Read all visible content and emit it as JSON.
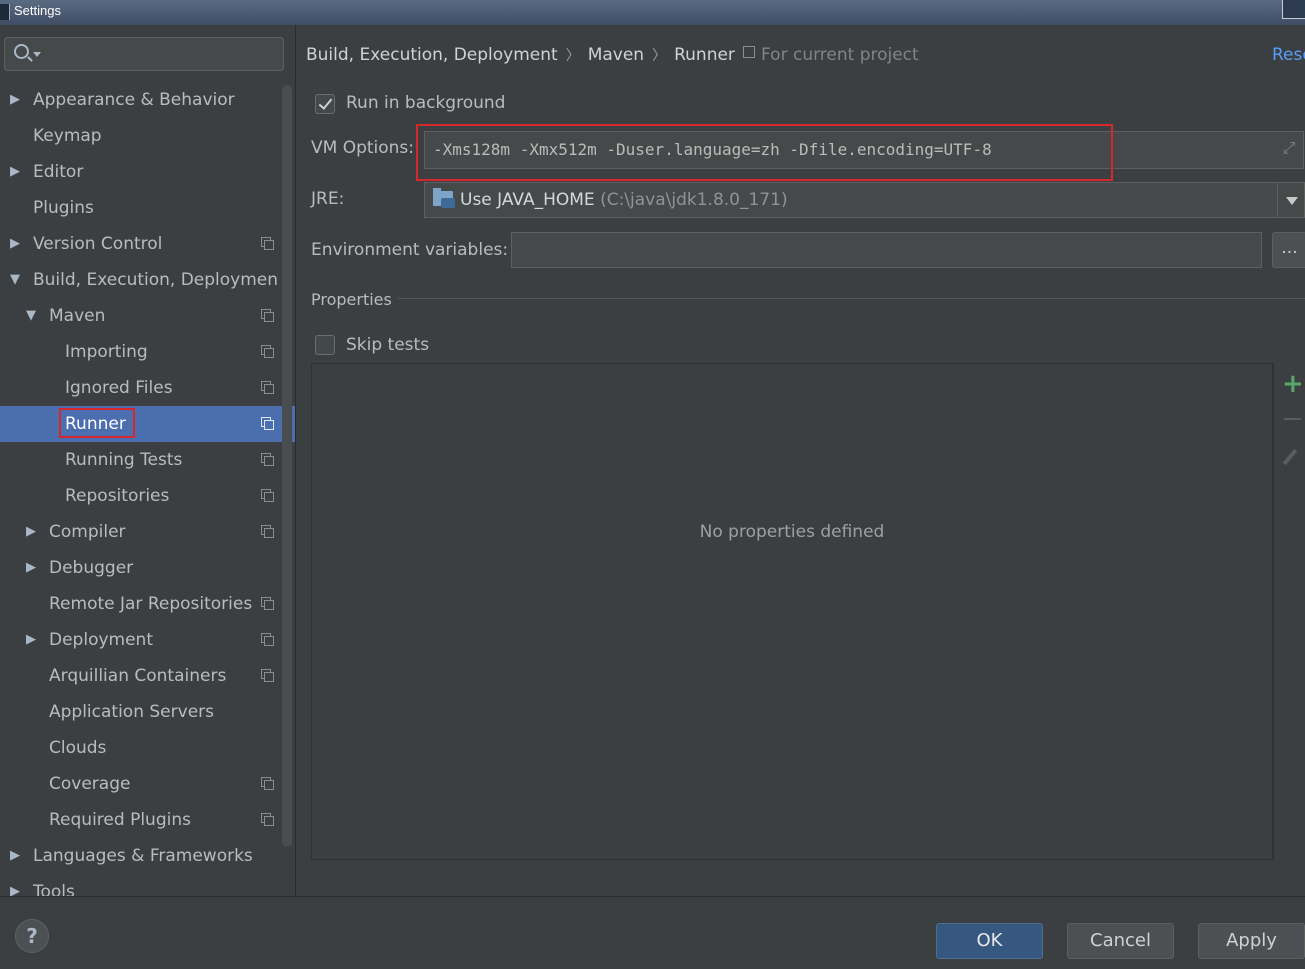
{
  "window": {
    "title": "Settings"
  },
  "search": {
    "placeholder": ""
  },
  "tree": [
    {
      "label": "Appearance & Behavior",
      "arrow": "▶"
    },
    {
      "label": "Keymap",
      "arrow": ""
    },
    {
      "label": "Editor",
      "arrow": "▶"
    },
    {
      "label": "Plugins",
      "arrow": ""
    },
    {
      "label": "Version Control",
      "arrow": "▶"
    },
    {
      "label": "Build, Execution, Deploymen",
      "arrow": "▼"
    },
    {
      "label": "Maven",
      "arrow": "▼"
    },
    {
      "label": "Importing",
      "arrow": ""
    },
    {
      "label": "Ignored Files",
      "arrow": ""
    },
    {
      "label": "Runner",
      "arrow": ""
    },
    {
      "label": "Running Tests",
      "arrow": ""
    },
    {
      "label": "Repositories",
      "arrow": ""
    },
    {
      "label": "Compiler",
      "arrow": "▶"
    },
    {
      "label": "Debugger",
      "arrow": "▶"
    },
    {
      "label": "Remote Jar Repositories",
      "arrow": ""
    },
    {
      "label": "Deployment",
      "arrow": "▶"
    },
    {
      "label": "Arquillian Containers",
      "arrow": ""
    },
    {
      "label": "Application Servers",
      "arrow": ""
    },
    {
      "label": "Clouds",
      "arrow": ""
    },
    {
      "label": "Coverage",
      "arrow": ""
    },
    {
      "label": "Required Plugins",
      "arrow": ""
    },
    {
      "label": "Languages & Frameworks",
      "arrow": "▶"
    },
    {
      "label": "Tools",
      "arrow": "▶"
    }
  ],
  "breadcrumb": {
    "part1": "Build, Execution, Deployment",
    "part2": "Maven",
    "part3": "Runner",
    "separator": "〉"
  },
  "scope": {
    "label": "For current project"
  },
  "reset": {
    "label": "Rese"
  },
  "run_in_background": {
    "label": "Run in background",
    "checked": true
  },
  "vm_options": {
    "label": "VM Options:",
    "value": "-Xms128m -Xmx512m -Duser.language=zh -Dfile.encoding=UTF-8"
  },
  "jre": {
    "label": "JRE:",
    "value": "Use JAVA_HOME",
    "path": "(C:\\java\\jdk1.8.0_171)"
  },
  "env_vars": {
    "label": "Environment variables:",
    "button": "..."
  },
  "properties": {
    "section_label": "Properties",
    "empty_text": "No properties defined"
  },
  "skip_tests": {
    "label": "Skip tests",
    "checked": false
  },
  "toolbar": {
    "add": "+"
  },
  "buttons": {
    "help": "?",
    "ok": "OK",
    "cancel": "Cancel",
    "apply": "Apply"
  },
  "colors": {
    "accent": "#4b6eaf",
    "highlight": "#d6262e",
    "link": "#589df6",
    "add": "#59a869"
  }
}
